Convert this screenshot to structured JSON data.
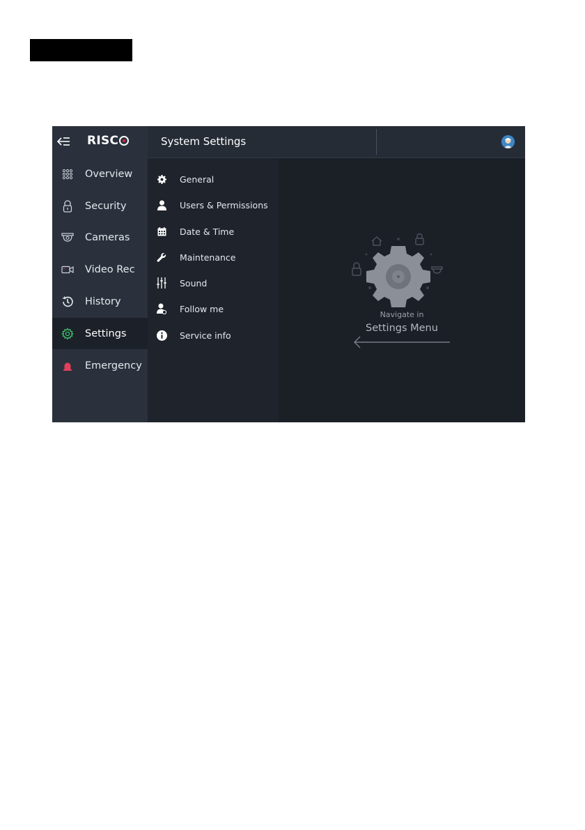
{
  "app": {
    "logo_text": "RISC",
    "header_title": "System Settings"
  },
  "nav": {
    "items": [
      {
        "label": "Overview",
        "icon": "grid-dots-icon"
      },
      {
        "label": "Security",
        "icon": "padlock-icon"
      },
      {
        "label": "Cameras",
        "icon": "camera-dome-icon"
      },
      {
        "label": "Video Rec",
        "icon": "video-camera-icon"
      },
      {
        "label": "History",
        "icon": "history-clock-icon"
      },
      {
        "label": "Settings",
        "icon": "gear-icon",
        "active": true
      },
      {
        "label": "Emergency",
        "icon": "siren-icon"
      }
    ]
  },
  "submenu": {
    "items": [
      {
        "label": "General",
        "icon": "cog-icon"
      },
      {
        "label": "Users & Permissions",
        "icon": "user-icon"
      },
      {
        "label": "Date & Time",
        "icon": "calendar-icon"
      },
      {
        "label": "Maintenance",
        "icon": "wrench-icon"
      },
      {
        "label": "Sound",
        "icon": "equalizer-icon"
      },
      {
        "label": "Follow me",
        "icon": "follow-me-icon"
      },
      {
        "label": "Service info",
        "icon": "info-icon"
      }
    ]
  },
  "content": {
    "hint_line1": "Navigate in",
    "hint_line2": "Settings Menu"
  },
  "colors": {
    "accent_active": "#3ec46d",
    "emergency": "#e0405a",
    "nav_bg": "#2a313d",
    "content_bg": "#1b1f26"
  }
}
